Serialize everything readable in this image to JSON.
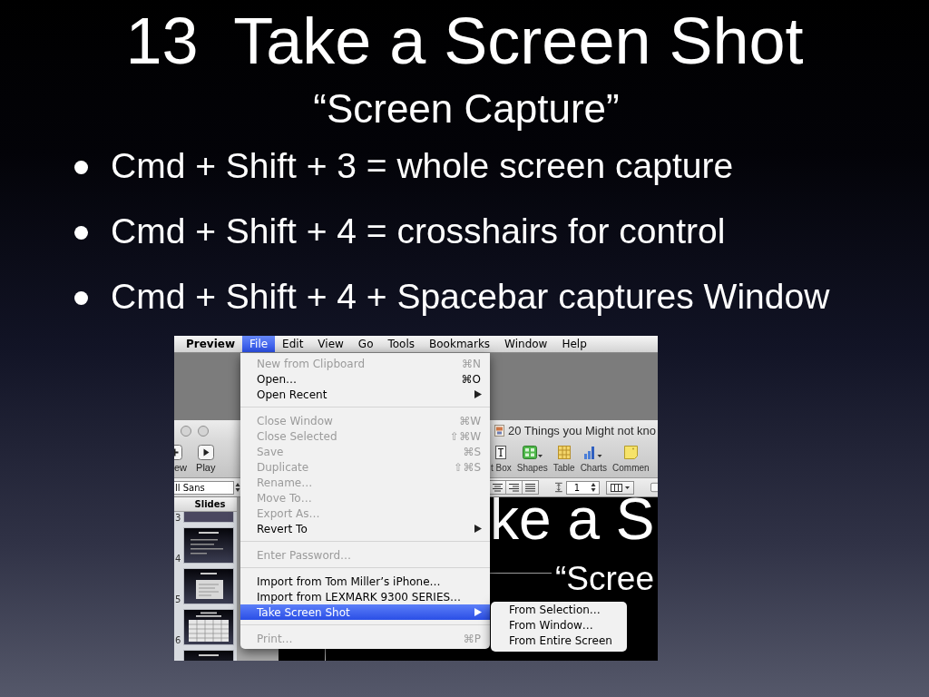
{
  "slide": {
    "title": "13  Take a Screen Shot",
    "subtitle": "“Screen Capture”",
    "bullets": [
      "Cmd + Shift + 3 = whole screen capture",
      "Cmd + Shift + 4 = crosshairs for control",
      "Cmd + Shift + 4 + Spacebar captures Window"
    ]
  },
  "screenshot": {
    "menubar": [
      {
        "label": "Preview",
        "kind": "app",
        "selected": false
      },
      {
        "label": "File",
        "kind": "menu",
        "selected": true
      },
      {
        "label": "Edit",
        "kind": "menu",
        "selected": false
      },
      {
        "label": "View",
        "kind": "menu",
        "selected": false
      },
      {
        "label": "Go",
        "kind": "menu",
        "selected": false
      },
      {
        "label": "Tools",
        "kind": "menu",
        "selected": false
      },
      {
        "label": "Bookmarks",
        "kind": "menu",
        "selected": false
      },
      {
        "label": "Window",
        "kind": "menu",
        "selected": false
      },
      {
        "label": "Help",
        "kind": "menu",
        "selected": false
      }
    ],
    "window": {
      "title": "20 Things you Might not kno",
      "toolbar_left": [
        {
          "label": "ew",
          "kind": "new"
        },
        {
          "label": "Play",
          "kind": "play"
        }
      ],
      "toolbar_right": [
        {
          "label": "t Box",
          "kind": "text-box"
        },
        {
          "label": "Shapes",
          "kind": "shapes"
        },
        {
          "label": "Table",
          "kind": "table"
        },
        {
          "label": "Charts",
          "kind": "charts"
        },
        {
          "label": "Commen",
          "kind": "comment"
        }
      ],
      "font_field": {
        "value": "ll Sans"
      },
      "line_spacing_field": {
        "value": "1"
      },
      "sidebar": {
        "header": "Slides",
        "thumbnails": [
          {
            "number": "3",
            "kind": "blank"
          },
          {
            "number": "4",
            "kind": "text"
          },
          {
            "number": "5",
            "kind": "picture"
          },
          {
            "number": "6",
            "kind": "table"
          },
          {
            "kind": "text"
          }
        ]
      },
      "canvas": {
        "title": "ke a S",
        "subtitle": "“Scree"
      }
    },
    "file_menu": [
      {
        "kind": "item",
        "label": "New from Clipboard",
        "shortcut": "⌘N",
        "submenu": false,
        "disabled": true,
        "selected": false
      },
      {
        "kind": "item",
        "label": "Open…",
        "shortcut": "⌘O",
        "submenu": false,
        "disabled": false,
        "selected": false
      },
      {
        "kind": "item",
        "label": "Open Recent",
        "submenu": true,
        "disabled": false,
        "selected": false
      },
      {
        "kind": "separator"
      },
      {
        "kind": "item",
        "label": "Close Window",
        "shortcut": "⌘W",
        "submenu": false,
        "disabled": true,
        "selected": false
      },
      {
        "kind": "item",
        "label": "Close Selected",
        "shortcut": "⇧⌘W",
        "submenu": false,
        "disabled": true,
        "selected": false
      },
      {
        "kind": "item",
        "label": "Save",
        "shortcut": "⌘S",
        "submenu": false,
        "disabled": true,
        "selected": false
      },
      {
        "kind": "item",
        "label": "Duplicate",
        "shortcut": "⇧⌘S",
        "submenu": false,
        "disabled": true,
        "selected": false
      },
      {
        "kind": "item",
        "label": "Rename…",
        "submenu": false,
        "disabled": true,
        "selected": false
      },
      {
        "kind": "item",
        "label": "Move To…",
        "submenu": false,
        "disabled": true,
        "selected": false
      },
      {
        "kind": "item",
        "label": "Export As…",
        "submenu": false,
        "disabled": true,
        "selected": false
      },
      {
        "kind": "item",
        "label": "Revert To",
        "submenu": true,
        "disabled": false,
        "selected": false
      },
      {
        "kind": "separator"
      },
      {
        "kind": "item",
        "label": "Enter Password…",
        "submenu": false,
        "disabled": true,
        "selected": false
      },
      {
        "kind": "separator"
      },
      {
        "kind": "item",
        "label": "Import from Tom Miller’s iPhone…",
        "submenu": false,
        "disabled": false,
        "selected": false
      },
      {
        "kind": "item",
        "label": "Import from LEXMARK 9300 SERIES…",
        "submenu": false,
        "disabled": false,
        "selected": false
      },
      {
        "kind": "item",
        "label": "Take Screen Shot",
        "submenu": true,
        "disabled": false,
        "selected": true
      },
      {
        "kind": "separator"
      },
      {
        "kind": "item",
        "label": "Print…",
        "shortcut": "⌘P",
        "submenu": false,
        "disabled": true,
        "selected": false
      }
    ],
    "submenu": [
      {
        "label": "From Selection…",
        "selected": false
      },
      {
        "label": "From Window…",
        "selected": false
      },
      {
        "label": "From Entire Screen",
        "selected": false
      }
    ]
  }
}
